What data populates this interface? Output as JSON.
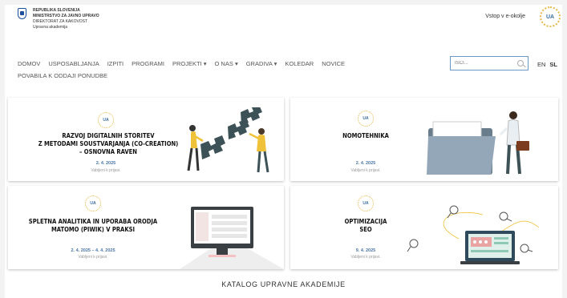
{
  "header": {
    "gov_lines": [
      "REPUBLIKA SLOVENIJA",
      "MINISTRSTVO ZA JAVNO UPRAVO",
      "DIREKTORAT ZA KAKOVOST",
      "Upravna akademija"
    ],
    "login": "Vstop v e-okolje",
    "logo_text": "UA"
  },
  "nav": {
    "items": [
      "DOMOV",
      "USPOSABLJANJA",
      "IZPITI",
      "PROGRAMI",
      "PROJEKTI",
      "O NAS",
      "GRADIVA",
      "KOLEDAR",
      "NOVICE"
    ],
    "item2": "POVABILA K ODDAJI PONUDBE"
  },
  "search": {
    "placeholder": "ISČI..."
  },
  "lang": {
    "en": "EN",
    "sl": "SL"
  },
  "cards": [
    {
      "badge": "UA",
      "title": "RAZVOJ DIGITALNIH STORITEV\nZ METODAMI SOUSTVARJANJA (CO-CREATION)\n– OSNOVNA RAVEN",
      "date": "2. 4. 2025",
      "invite": "Vabljeni k prijavi.",
      "art": "puzzle-people"
    },
    {
      "badge": "UA",
      "title": "NOMOTEHNIKA",
      "date": "2. 4. 2025",
      "invite": "Vabljeni k prijavi.",
      "art": "folder-man"
    },
    {
      "badge": "UA",
      "title": "SPLETNA ANALITIKA IN UPORABA ORODJA\nMATOMO (PIWIK) V PRAKSI",
      "date": "2. 4. 2025 – 4. 4. 2025",
      "invite": "Vabljeni k prijavi.",
      "art": "monitor"
    },
    {
      "badge": "UA",
      "title": "OPTIMIZACIJA\nSEO",
      "date": "9. 4. 2025",
      "invite": "Vabljeni k prijavi.",
      "art": "seo-laptop"
    }
  ],
  "catalog": "KATALOG UPRAVNE AKADEMIJE",
  "colors": {
    "accent": "#4a76a8",
    "badge_ring": "#e7b84a",
    "puzzle": "#3d5257"
  }
}
